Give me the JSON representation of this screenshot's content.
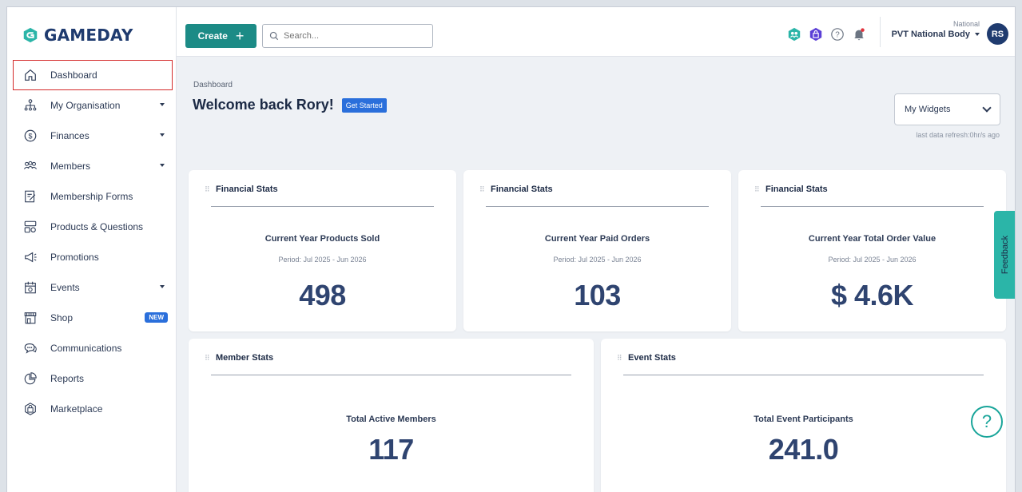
{
  "brand": {
    "name": "GAMEDAY"
  },
  "sidebar": {
    "items": [
      {
        "label": "Dashboard",
        "icon": "home-icon",
        "active": true
      },
      {
        "label": "My Organisation",
        "icon": "org-chart-icon",
        "caret": true
      },
      {
        "label": "Finances",
        "icon": "dollar-circle-icon",
        "caret": true
      },
      {
        "label": "Members",
        "icon": "people-icon",
        "caret": true
      },
      {
        "label": "Membership Forms",
        "icon": "form-edit-icon"
      },
      {
        "label": "Products & Questions",
        "icon": "products-icon"
      },
      {
        "label": "Promotions",
        "icon": "megaphone-icon"
      },
      {
        "label": "Events",
        "icon": "calendar-icon",
        "caret": true
      },
      {
        "label": "Shop",
        "icon": "storefront-icon",
        "badge": "NEW"
      },
      {
        "label": "Communications",
        "icon": "chat-bubbles-icon"
      },
      {
        "label": "Reports",
        "icon": "pie-chart-icon"
      },
      {
        "label": "Marketplace",
        "icon": "bag-icon"
      }
    ]
  },
  "topbar": {
    "create_label": "Create",
    "search_placeholder": "Search...",
    "org_level": "National",
    "org_name": "PVT National Body",
    "avatar_initials": "RS"
  },
  "main": {
    "breadcrumb": "Dashboard",
    "welcome": "Welcome back Rory!",
    "get_started": "Get Started",
    "widgets_select": "My Widgets",
    "refresh_text": "last data refresh:0hr/s ago"
  },
  "cards": {
    "products": {
      "title": "Financial Stats",
      "label": "Current Year Products Sold",
      "period": "Period: Jul 2025 - Jun 2026",
      "value": "498"
    },
    "orders": {
      "title": "Financial Stats",
      "label": "Current Year Paid Orders",
      "period": "Period: Jul 2025 - Jun 2026",
      "value": "103"
    },
    "order_value": {
      "title": "Financial Stats",
      "label": "Current Year Total Order Value",
      "period": "Period: Jul 2025 - Jun 2026",
      "value": "$ 4.6K"
    },
    "members": {
      "title": "Member Stats",
      "label": "Total Active Members",
      "value": "117"
    },
    "events": {
      "title": "Event Stats",
      "label": "Total Event Participants",
      "value": "241.0"
    }
  },
  "feedback": {
    "label": "Feedback"
  },
  "colors": {
    "brand_navy": "#1f3b6f",
    "teal": "#1c8b86",
    "blue": "#2a6fdb",
    "highlight_red": "#d42a2a"
  }
}
